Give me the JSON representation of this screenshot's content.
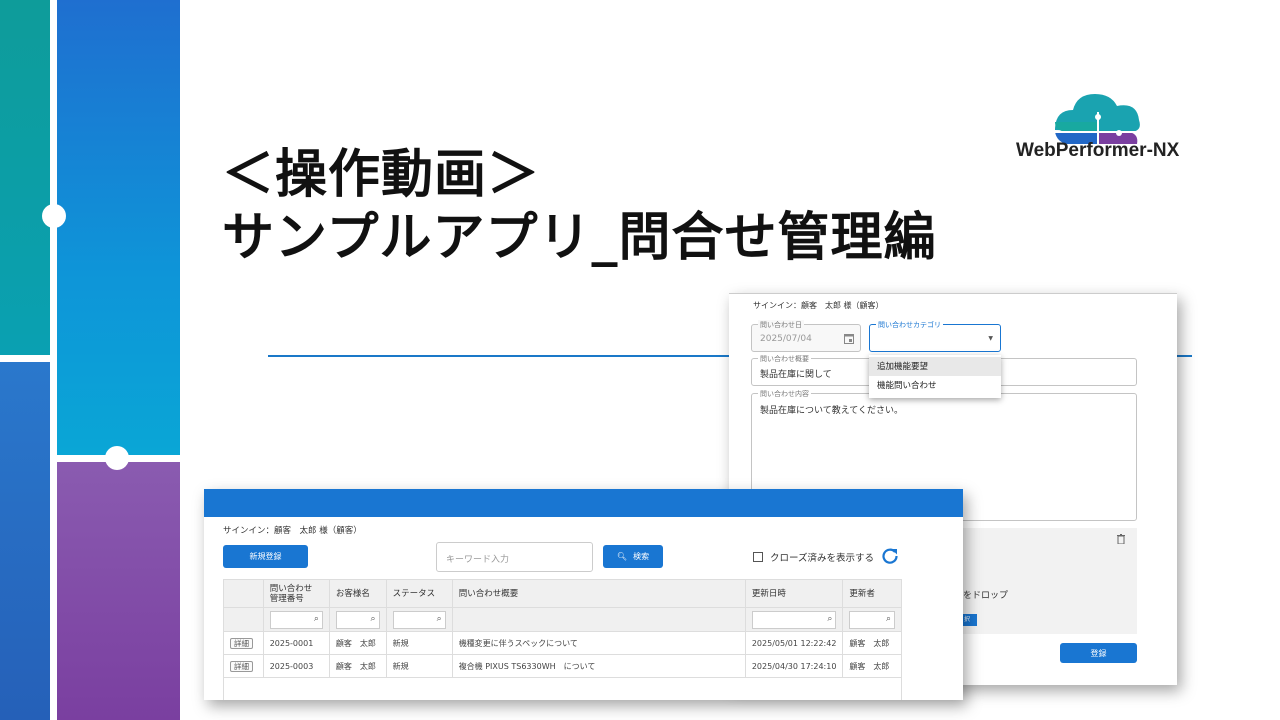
{
  "title": {
    "line1": "＜操作動画＞",
    "line2": "サンプルアプリ_問合せ管理編"
  },
  "logo": {
    "text": "WebPerformer-NX"
  },
  "form": {
    "signin": "サインイン：顧客　太郎 様（顧客）",
    "date_label": "問い合わせ日",
    "date_value": "2025/07/04",
    "category_label": "問い合わせカテゴリ",
    "category_options": [
      "追加機能要望",
      "機能問い合わせ"
    ],
    "summary_label": "問い合わせ概要",
    "summary_value": "製品在庫に関して",
    "content_label": "問い合わせ内容",
    "content_value": "製品在庫について教えてください。",
    "drop_text": "イルをドロップ",
    "select_partial": "択",
    "register_label": "登録"
  },
  "list": {
    "signin": "サインイン：顧客　太郎 様（顧客）",
    "new_button": "新規登録",
    "keyword_placeholder": "キーワード入力",
    "search_button": "検索",
    "show_closed": "クローズ済みを表示する",
    "columns": [
      "",
      "問い合わせ\n管理番号",
      "お客様名",
      "ステータス",
      "問い合わせ概要",
      "更新日時",
      "更新者"
    ],
    "rows": [
      {
        "action": "詳細",
        "id": "2025-0001",
        "customer": "顧客　太郎",
        "status": "新規",
        "summary": "機種変更に伴うスペックについて",
        "updated": "2025/05/01 12:22:42",
        "updater": "顧客　太郎"
      },
      {
        "action": "詳細",
        "id": "2025-0003",
        "customer": "顧客　太郎",
        "status": "新規",
        "summary": "複合機 PIXUS TS6330WH　について",
        "updated": "2025/04/30 17:24:10",
        "updater": "顧客　太郎"
      }
    ]
  },
  "colors": {
    "primary": "#1976d2",
    "accent_line": "#1a78c8",
    "deco_teal": "#0a9aa6",
    "deco_blue": "#1f6fd0",
    "deco_purple": "#7a3fa0"
  }
}
